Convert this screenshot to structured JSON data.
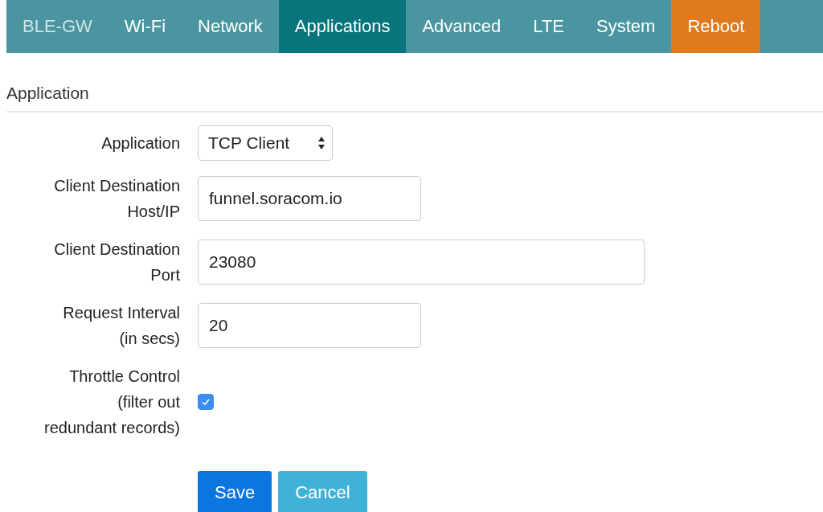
{
  "navbar": {
    "brand": "BLE-GW",
    "items": [
      {
        "label": "Wi-Fi",
        "selected": false,
        "kind": "link"
      },
      {
        "label": "Network",
        "selected": false,
        "kind": "link"
      },
      {
        "label": "Applications",
        "selected": true,
        "kind": "link"
      },
      {
        "label": "Advanced",
        "selected": false,
        "kind": "link"
      },
      {
        "label": "LTE",
        "selected": false,
        "kind": "link"
      },
      {
        "label": "System",
        "selected": false,
        "kind": "link"
      },
      {
        "label": "Reboot",
        "kind": "danger"
      }
    ]
  },
  "section": {
    "title": "Application"
  },
  "fields": [
    {
      "kind": "select",
      "label": [
        "Application"
      ],
      "value": "TCP Client"
    },
    {
      "kind": "text",
      "label": [
        "Client Destination",
        "Host/IP"
      ],
      "value": "funnel.soracom.io"
    },
    {
      "kind": "wide_text",
      "label": [
        "Client Destination",
        "Port"
      ],
      "value": "23080"
    },
    {
      "kind": "text",
      "label": [
        "Request Interval",
        "(in secs)"
      ],
      "value": "20"
    },
    {
      "kind": "checkbox",
      "label": [
        "Throttle Control",
        "(filter out",
        "redundant records)"
      ],
      "checked": true
    }
  ],
  "buttons": [
    {
      "label": "Save",
      "kind": "primary"
    },
    {
      "label": "Cancel",
      "kind": "secondary"
    }
  ]
}
